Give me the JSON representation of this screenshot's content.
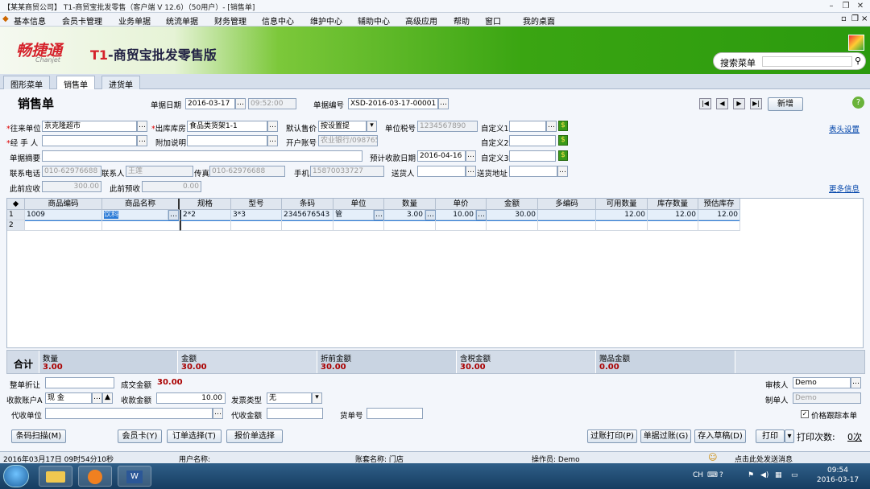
{
  "window": {
    "title": "【某某商贸公司】 T1-商贸宝批发零售（客户端 V 12.6）（50用户）- [销售单]"
  },
  "menu": [
    "基本信息",
    "会员卡管理",
    "业务单据",
    "统流单据",
    "财务管理",
    "信息中心",
    "维护中心",
    "辅助中心",
    "高级应用",
    "帮助",
    "窗口",
    "我的桌面"
  ],
  "banner": {
    "brand_cn": "畅捷通",
    "brand_en": "Chanjet",
    "product_prefix": "T1",
    "product": "-商贸宝批发零售版",
    "search_label": "搜索菜单"
  },
  "tabs": [
    "图形菜单",
    "销售单",
    "进货单"
  ],
  "header": {
    "page_title": "销售单",
    "date_label": "单据日期",
    "date": "2016-03-17",
    "time": "09:52:00",
    "billno_label": "单据编号",
    "billno": "XSD-2016-03-17-00001",
    "new_button": "新增",
    "header_settings": "表头设置",
    "more_info": "更多信息"
  },
  "fields": {
    "customer_label": "往来单位",
    "customer": "京克隆超市",
    "warehouse_label": "出库库房",
    "warehouse": "食品类货架1-1",
    "price_label": "默认售价",
    "price": "按设置提",
    "taxno_label": "单位税号",
    "taxno": "1234567890",
    "custom1_label": "自定义1",
    "custom2_label": "自定义2",
    "custom3_label": "自定义3",
    "handler_label": "经 手 人",
    "handler": "",
    "extra_label": "附加说明",
    "extra": "",
    "account_label": "开户账号",
    "account": "农业银行/098765",
    "summary_label": "单据摘要",
    "summary": "",
    "due_label": "预计收款日期",
    "due": "2016-04-16",
    "phone_label": "联系电话",
    "phone": "010-62976688",
    "contact_label": "联系人",
    "contact": "王莲",
    "fax_label": "传真",
    "fax": "010-62976688",
    "mobile_label": "手机",
    "mobile": "15870033727",
    "deliverer_label": "送货人",
    "deliverer": "",
    "address_label": "送货地址",
    "address": "",
    "prev_recv_label": "此前应收",
    "prev_recv": "300.00",
    "prev_adv_label": "此前预收",
    "prev_adv": "0.00"
  },
  "grid": {
    "columns": [
      "商品编码",
      "商品名称",
      "规格",
      "型号",
      "条码",
      "单位",
      "数量",
      "单价",
      "金额",
      "多编码",
      "可用数量",
      "库存数量",
      "预估库存"
    ],
    "rows": [
      {
        "no": "1",
        "code": "1009",
        "name": "饮料",
        "spec": "2*2",
        "model": "3*3",
        "barcode": "2345676543",
        "unit": "管",
        "qty": "3.00",
        "price": "10.00",
        "amount": "30.00",
        "multi": "",
        "avail": "12.00",
        "stock": "12.00",
        "est": "12.00"
      },
      {
        "no": "2"
      }
    ]
  },
  "totals": {
    "label": "合计",
    "qty_label": "数量",
    "qty": "3.00",
    "amount_label": "金额",
    "amount": "30.00",
    "disc_label": "折前金额",
    "disc": "30.00",
    "tax_label": "含税金额",
    "tax": "30.00",
    "gift_label": "赠品金额",
    "gift": "0.00"
  },
  "footer": {
    "discount_label": "整单折让",
    "discount": "",
    "deal_label": "成交金额",
    "deal": "30.00",
    "recv_acct_label": "收款账户A",
    "recv_acct": "现    金",
    "recv_amt_label": "收款金额",
    "recv_amt": "10.00",
    "invoice_label": "发票类型",
    "invoice": "无",
    "agent_label": "代收单位",
    "agent": "",
    "agent_amt_label": "代收金额",
    "agent_amt": "",
    "cargo_label": "货单号",
    "cargo": "",
    "auditor_label": "审核人",
    "auditor": "Demo",
    "maker_label": "制单人",
    "maker": "Demo",
    "track_label": "价格跟踪本单",
    "buttons": [
      "条码扫描(M)",
      "会员卡(Y)",
      "订单选择(T)",
      "报价单选择",
      "过账打印(P)",
      "单据过账(G)",
      "存入草稿(D)",
      "打印"
    ],
    "print_count_label": "打印次数:",
    "print_count": "0次"
  },
  "status": {
    "datetime": "2016年03月17日  09时54分10秒",
    "user_label": "用户名称:",
    "set_label": "账套名称: 门店",
    "operator_label": "操作员: Demo",
    "msg": "点击此处发送消息"
  },
  "taskbar": {
    "time": "09:54",
    "date": "2016-03-17",
    "lang": "CH"
  }
}
